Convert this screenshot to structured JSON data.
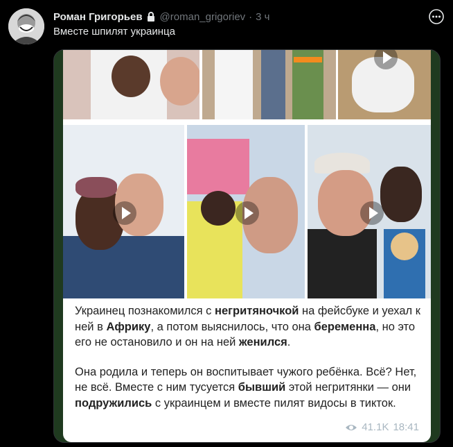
{
  "author": {
    "name": "Роман Григорьев",
    "handle": "@roman_grigoriev",
    "separator": "·",
    "time": "3 ч"
  },
  "tweet": {
    "text": "Вместе шпилят украинца"
  },
  "post": {
    "paragraph1": {
      "t1": "Украинец познакомился с ",
      "b1": "негритяночкой",
      "t2": " на фейсбуке и уехал к ней в ",
      "b2": "Африку",
      "t3": ", а потом выяснилось, что она ",
      "b3": "беременна",
      "t4": ", но это его не остановило и он на ней ",
      "b4": "женился",
      "t5": "."
    },
    "paragraph2": {
      "t1": "Она родила и теперь он воспитывает чужого ребёнка. Всё? Нет, не всё. Вместе с ним тусуется ",
      "b1": "бывший",
      "t2": " этой негритянки — они ",
      "b2": "подружились",
      "t3": " с украинцем и вместе пилят видосы в тикток."
    },
    "views": "41.1K",
    "time": "18:41"
  },
  "icons": {
    "lock": "lock-icon",
    "more": "more-icon",
    "play": "play-icon",
    "eye": "eye-icon"
  },
  "colors": {
    "background": "#000000",
    "text": "#e7e9ea",
    "muted": "#71767b",
    "card": "#ffffff"
  }
}
